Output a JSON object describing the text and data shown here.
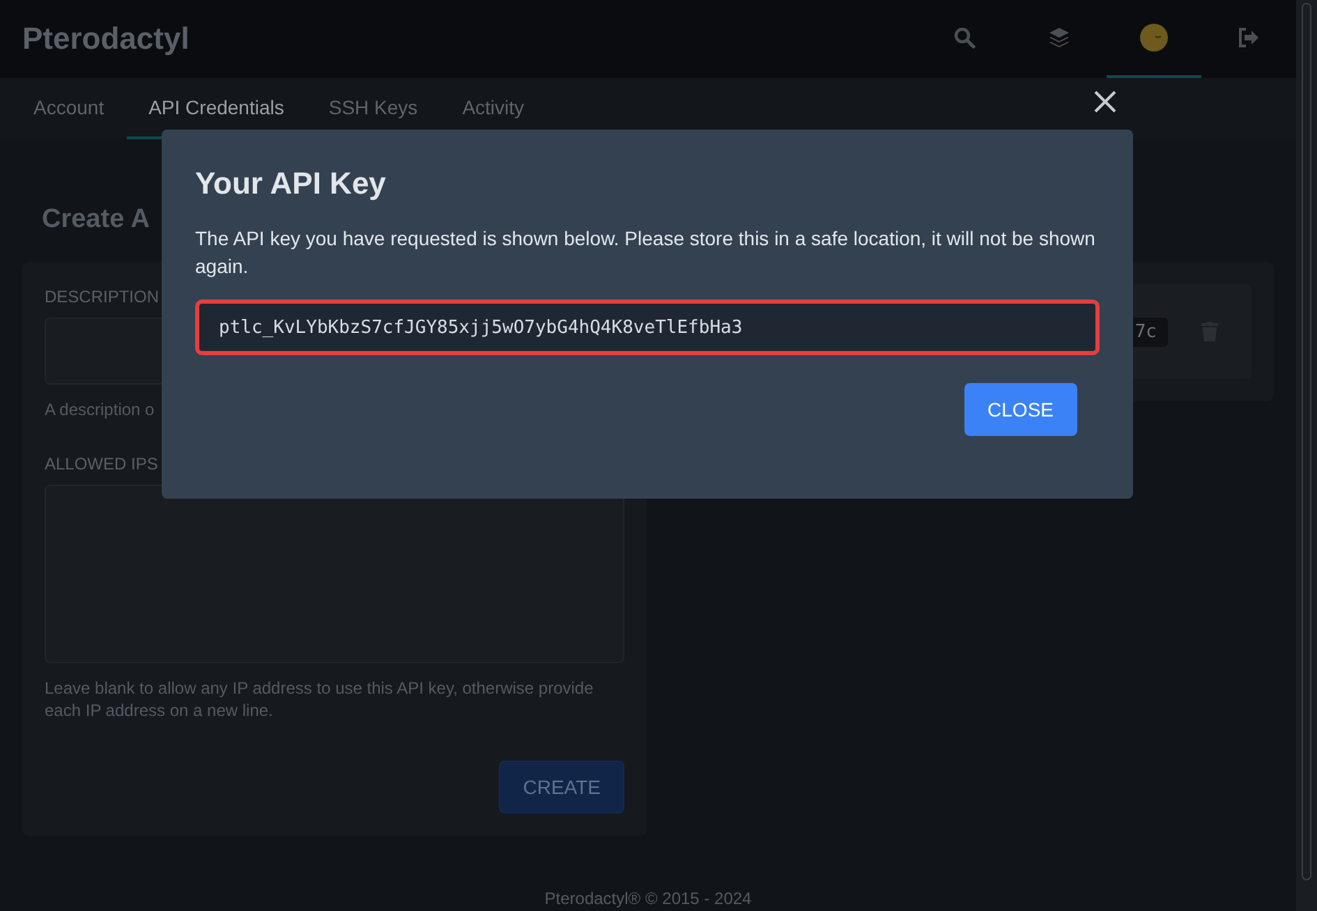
{
  "header": {
    "brand": "Pterodactyl",
    "nav": [
      {
        "kind": "search",
        "selected": false
      },
      {
        "kind": "layers",
        "selected": false
      },
      {
        "kind": "avatar",
        "selected": true
      },
      {
        "kind": "logout",
        "selected": false
      }
    ]
  },
  "tabs": [
    {
      "label": "Account",
      "selected": false
    },
    {
      "label": "API Credentials",
      "selected": true
    },
    {
      "label": "SSH Keys",
      "selected": false
    },
    {
      "label": "Activity",
      "selected": false
    }
  ],
  "create_panel": {
    "heading": "Create A",
    "description_label": "DESCRIPTION",
    "description_help": "A description o",
    "allowed_ips_label": "ALLOWED IPS",
    "allowed_ips_help": "Leave blank to allow any IP address to use this API key, otherwise provide each IP address on a new line.",
    "create_button": "CREATE"
  },
  "keys_panel": {
    "keys": [
      {
        "identifier": "7c"
      }
    ]
  },
  "modal": {
    "title": "Your API Key",
    "message": "The API key you have requested is shown below. Please store this in a safe location, it will not be shown again.",
    "api_key": "ptlc_KvLYbKbzS7cfJGY85xjj5wO7ybG4hQ4K8veTlEfbHa3",
    "close_button": "CLOSE"
  },
  "footer": "Pterodactyl® © 2015 - 2024"
}
